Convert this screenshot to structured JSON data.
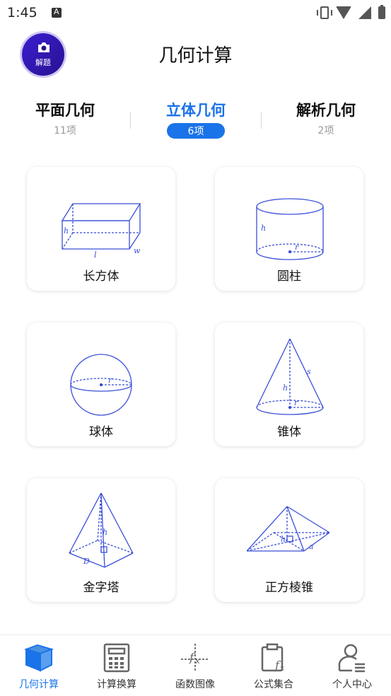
{
  "status_bar": {
    "time": "1:45"
  },
  "header": {
    "camera_label": "解题",
    "title": "几何计算"
  },
  "tabs": [
    {
      "name": "平面几何",
      "count": "11项"
    },
    {
      "name": "立体几何",
      "count": "6项"
    },
    {
      "name": "解析几何",
      "count": "2项"
    }
  ],
  "cards": [
    {
      "label": "长方体",
      "icon": "cuboid-figure"
    },
    {
      "label": "圆柱",
      "icon": "cylinder-figure"
    },
    {
      "label": "球体",
      "icon": "sphere-figure"
    },
    {
      "label": "锥体",
      "icon": "cone-figure"
    },
    {
      "label": "金字塔",
      "icon": "pyramid-figure"
    },
    {
      "label": "正方棱锥",
      "icon": "square-pyramid-figure"
    }
  ],
  "figure_labels": {
    "h": "h",
    "l": "l",
    "w": "w",
    "r": "r",
    "s": "s",
    "D": "D",
    "a": "a"
  },
  "bottom_nav": [
    {
      "label": "几何计算",
      "icon": "cube-icon"
    },
    {
      "label": "计算换算",
      "icon": "calculator-icon"
    },
    {
      "label": "函数图像",
      "icon": "function-graph-icon"
    },
    {
      "label": "公式集合",
      "icon": "clipboard-formula-icon"
    },
    {
      "label": "个人中心",
      "icon": "person-icon"
    }
  ],
  "colors": {
    "accent": "#1a73e8",
    "figure_stroke": "#3b4fd8",
    "camera_button": "#2a1090"
  }
}
